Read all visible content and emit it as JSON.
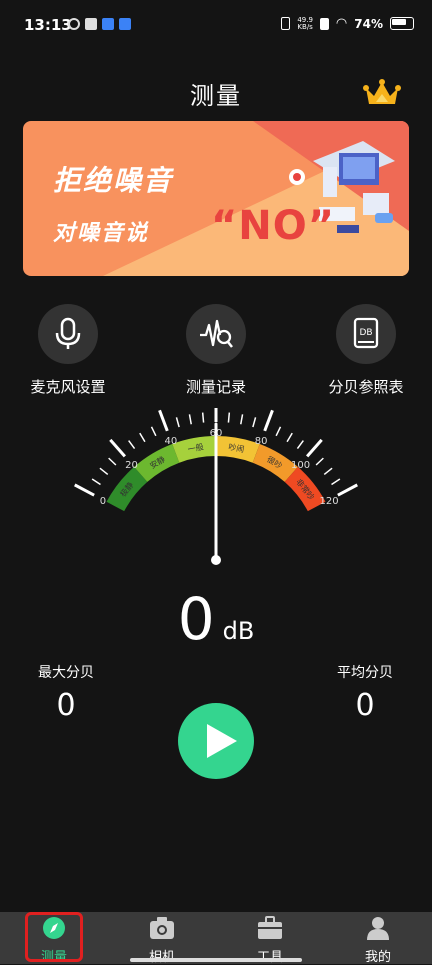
{
  "status_bar": {
    "time": "13:13",
    "net_speed_value": "49.9",
    "net_speed_unit": "KB/s",
    "battery": "74%"
  },
  "header": {
    "title": "测量"
  },
  "banner": {
    "line1": "拒绝噪音",
    "line2": "对噪音说",
    "emphasis": "“NO”"
  },
  "features": [
    {
      "label": "麦克风设置",
      "icon": "microphone-icon"
    },
    {
      "label": "测量记录",
      "icon": "waveform-search-icon"
    },
    {
      "label": "分贝参照表",
      "icon": "db-table-icon"
    }
  ],
  "gauge": {
    "ticks": [
      "0",
      "20",
      "40",
      "60",
      "80",
      "100",
      "120"
    ],
    "zones": [
      "极静",
      "安静",
      "一般",
      "吵闹",
      "很吵",
      "非常吵"
    ],
    "zone_colors": [
      "#2f8c2a",
      "#6cb82f",
      "#a6d13c",
      "#f2c335",
      "#f29a2a",
      "#ef4a22"
    ],
    "needle_value": 60,
    "max_value": 120
  },
  "reading": {
    "value": "0",
    "unit": "dB"
  },
  "stats": {
    "max": {
      "label": "最大分贝",
      "value": "0"
    },
    "avg": {
      "label": "平均分贝",
      "value": "0"
    }
  },
  "tabs": [
    {
      "label": "测量",
      "icon": "compass-icon",
      "active": true
    },
    {
      "label": "相机",
      "icon": "camera-icon",
      "active": false
    },
    {
      "label": "工具",
      "icon": "toolbox-icon",
      "active": false
    },
    {
      "label": "我的",
      "icon": "user-icon",
      "active": false
    }
  ],
  "colors": {
    "accent": "#34d58f",
    "background": "#141414",
    "banner_orange": "#f8925e"
  }
}
